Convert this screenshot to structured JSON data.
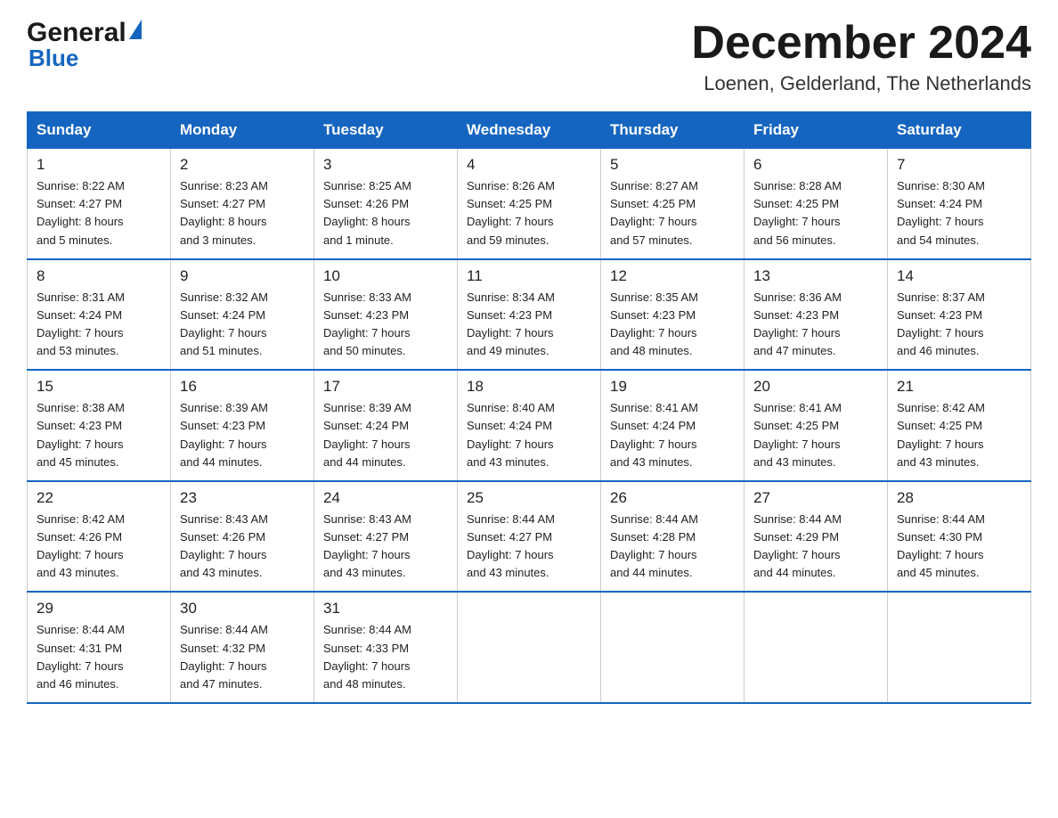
{
  "header": {
    "logo_general": "General",
    "logo_blue": "Blue",
    "month_year": "December 2024",
    "location": "Loenen, Gelderland, The Netherlands"
  },
  "weekdays": [
    "Sunday",
    "Monday",
    "Tuesday",
    "Wednesday",
    "Thursday",
    "Friday",
    "Saturday"
  ],
  "weeks": [
    [
      {
        "day": "1",
        "info": "Sunrise: 8:22 AM\nSunset: 4:27 PM\nDaylight: 8 hours\nand 5 minutes."
      },
      {
        "day": "2",
        "info": "Sunrise: 8:23 AM\nSunset: 4:27 PM\nDaylight: 8 hours\nand 3 minutes."
      },
      {
        "day": "3",
        "info": "Sunrise: 8:25 AM\nSunset: 4:26 PM\nDaylight: 8 hours\nand 1 minute."
      },
      {
        "day": "4",
        "info": "Sunrise: 8:26 AM\nSunset: 4:25 PM\nDaylight: 7 hours\nand 59 minutes."
      },
      {
        "day": "5",
        "info": "Sunrise: 8:27 AM\nSunset: 4:25 PM\nDaylight: 7 hours\nand 57 minutes."
      },
      {
        "day": "6",
        "info": "Sunrise: 8:28 AM\nSunset: 4:25 PM\nDaylight: 7 hours\nand 56 minutes."
      },
      {
        "day": "7",
        "info": "Sunrise: 8:30 AM\nSunset: 4:24 PM\nDaylight: 7 hours\nand 54 minutes."
      }
    ],
    [
      {
        "day": "8",
        "info": "Sunrise: 8:31 AM\nSunset: 4:24 PM\nDaylight: 7 hours\nand 53 minutes."
      },
      {
        "day": "9",
        "info": "Sunrise: 8:32 AM\nSunset: 4:24 PM\nDaylight: 7 hours\nand 51 minutes."
      },
      {
        "day": "10",
        "info": "Sunrise: 8:33 AM\nSunset: 4:23 PM\nDaylight: 7 hours\nand 50 minutes."
      },
      {
        "day": "11",
        "info": "Sunrise: 8:34 AM\nSunset: 4:23 PM\nDaylight: 7 hours\nand 49 minutes."
      },
      {
        "day": "12",
        "info": "Sunrise: 8:35 AM\nSunset: 4:23 PM\nDaylight: 7 hours\nand 48 minutes."
      },
      {
        "day": "13",
        "info": "Sunrise: 8:36 AM\nSunset: 4:23 PM\nDaylight: 7 hours\nand 47 minutes."
      },
      {
        "day": "14",
        "info": "Sunrise: 8:37 AM\nSunset: 4:23 PM\nDaylight: 7 hours\nand 46 minutes."
      }
    ],
    [
      {
        "day": "15",
        "info": "Sunrise: 8:38 AM\nSunset: 4:23 PM\nDaylight: 7 hours\nand 45 minutes."
      },
      {
        "day": "16",
        "info": "Sunrise: 8:39 AM\nSunset: 4:23 PM\nDaylight: 7 hours\nand 44 minutes."
      },
      {
        "day": "17",
        "info": "Sunrise: 8:39 AM\nSunset: 4:24 PM\nDaylight: 7 hours\nand 44 minutes."
      },
      {
        "day": "18",
        "info": "Sunrise: 8:40 AM\nSunset: 4:24 PM\nDaylight: 7 hours\nand 43 minutes."
      },
      {
        "day": "19",
        "info": "Sunrise: 8:41 AM\nSunset: 4:24 PM\nDaylight: 7 hours\nand 43 minutes."
      },
      {
        "day": "20",
        "info": "Sunrise: 8:41 AM\nSunset: 4:25 PM\nDaylight: 7 hours\nand 43 minutes."
      },
      {
        "day": "21",
        "info": "Sunrise: 8:42 AM\nSunset: 4:25 PM\nDaylight: 7 hours\nand 43 minutes."
      }
    ],
    [
      {
        "day": "22",
        "info": "Sunrise: 8:42 AM\nSunset: 4:26 PM\nDaylight: 7 hours\nand 43 minutes."
      },
      {
        "day": "23",
        "info": "Sunrise: 8:43 AM\nSunset: 4:26 PM\nDaylight: 7 hours\nand 43 minutes."
      },
      {
        "day": "24",
        "info": "Sunrise: 8:43 AM\nSunset: 4:27 PM\nDaylight: 7 hours\nand 43 minutes."
      },
      {
        "day": "25",
        "info": "Sunrise: 8:44 AM\nSunset: 4:27 PM\nDaylight: 7 hours\nand 43 minutes."
      },
      {
        "day": "26",
        "info": "Sunrise: 8:44 AM\nSunset: 4:28 PM\nDaylight: 7 hours\nand 44 minutes."
      },
      {
        "day": "27",
        "info": "Sunrise: 8:44 AM\nSunset: 4:29 PM\nDaylight: 7 hours\nand 44 minutes."
      },
      {
        "day": "28",
        "info": "Sunrise: 8:44 AM\nSunset: 4:30 PM\nDaylight: 7 hours\nand 45 minutes."
      }
    ],
    [
      {
        "day": "29",
        "info": "Sunrise: 8:44 AM\nSunset: 4:31 PM\nDaylight: 7 hours\nand 46 minutes."
      },
      {
        "day": "30",
        "info": "Sunrise: 8:44 AM\nSunset: 4:32 PM\nDaylight: 7 hours\nand 47 minutes."
      },
      {
        "day": "31",
        "info": "Sunrise: 8:44 AM\nSunset: 4:33 PM\nDaylight: 7 hours\nand 48 minutes."
      },
      null,
      null,
      null,
      null
    ]
  ]
}
